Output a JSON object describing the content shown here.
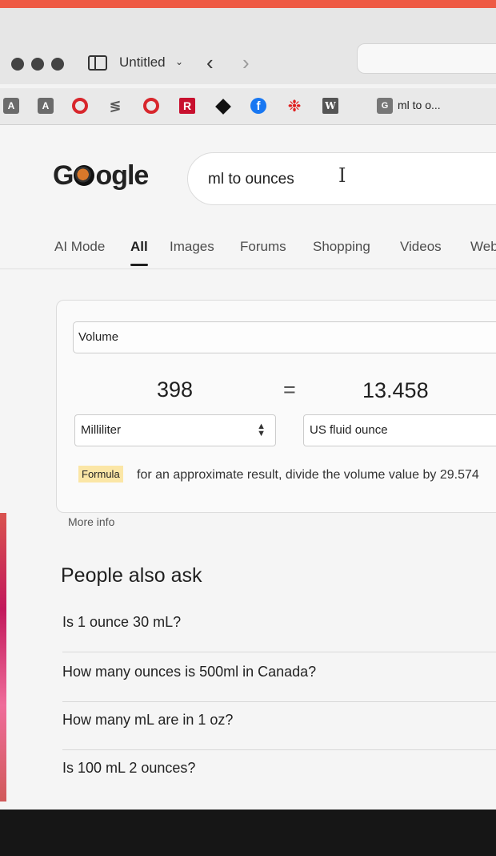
{
  "window": {
    "tab_title": "Untitled",
    "tab_chevron": "⌄",
    "back_icon": "‹",
    "forward_icon": "›"
  },
  "bookmarks": {
    "items": [
      {
        "icon": "a-icon",
        "text": "A"
      },
      {
        "icon": "a-icon",
        "text": "A"
      },
      {
        "icon": "red-ring-icon",
        "text": ""
      },
      {
        "icon": "stack-icon",
        "text": "≶"
      },
      {
        "icon": "red-ring-icon",
        "text": ""
      },
      {
        "icon": "r-logo-icon",
        "text": "R"
      },
      {
        "icon": "diamond-icon",
        "text": ""
      },
      {
        "icon": "facebook-icon",
        "text": "f"
      },
      {
        "icon": "cbc-icon",
        "text": "❉"
      },
      {
        "icon": "wikipedia-icon",
        "text": "W"
      },
      {
        "icon": "google-icon",
        "text": "G"
      }
    ],
    "google_tab_label": "ml to o..."
  },
  "google": {
    "logo_left": "G",
    "logo_right": "ogle",
    "search_query": "ml to ounces",
    "cursor_glyph": "I",
    "tabs": [
      "AI Mode",
      "All",
      "Images",
      "Forums",
      "Shopping",
      "Videos",
      "Web"
    ],
    "active_tab": "All"
  },
  "converter": {
    "unit_type": "Volume",
    "from_value": "398",
    "equals": "=",
    "to_value": "13.458",
    "from_unit": "Milliliter",
    "to_unit": "US fluid ounce",
    "formula_label": "Formula",
    "formula_text": "for an approximate result, divide the volume value by 29.574",
    "more_info": "More info"
  },
  "people_also_ask": {
    "title": "People also ask",
    "questions": [
      "Is 1 ounce 30 mL?",
      "How many ounces is 500ml in Canada?",
      "How many mL are in 1 oz?",
      "Is 100 mL 2 ounces?"
    ]
  },
  "colors": {
    "accent_strip": "#ee5a44",
    "formula_highlight": "#fbe6a6",
    "facebook": "#1877f2"
  }
}
